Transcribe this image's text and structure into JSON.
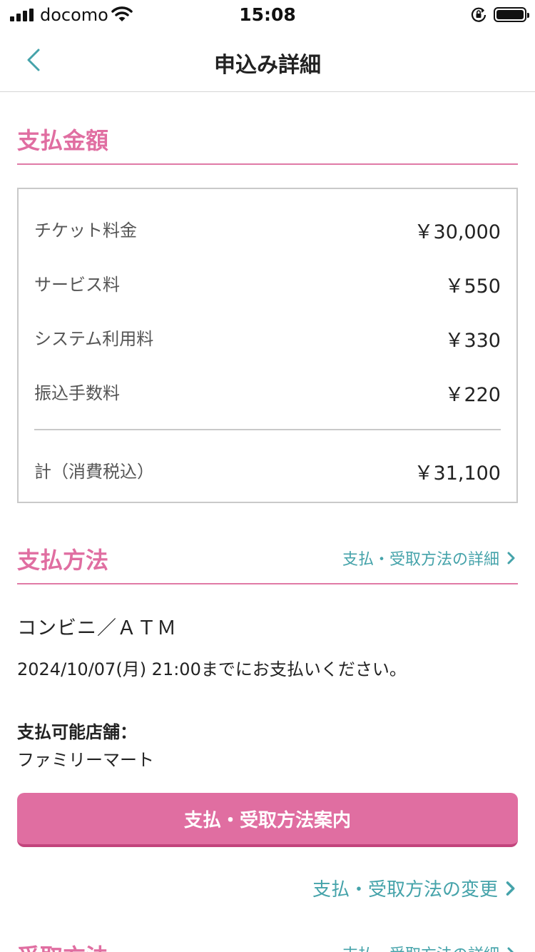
{
  "status_bar": {
    "carrier": "docomo",
    "time": "15:08",
    "signal_icon": "signal-bars-icon",
    "wifi_icon": "wifi-icon",
    "orientation_lock_icon": "orientation-lock-icon",
    "battery_icon": "battery-icon",
    "battery_level": 1.0
  },
  "nav": {
    "title": "申込み詳細",
    "back_icon": "chevron-left-icon"
  },
  "payment_amount": {
    "title": "支払金額",
    "rows": [
      {
        "label": "チケット料金",
        "value": "￥30,000"
      },
      {
        "label": "サービス料",
        "value": "￥550"
      },
      {
        "label": "システム利用料",
        "value": "￥330"
      },
      {
        "label": "振込手数料",
        "value": "￥220"
      }
    ],
    "total": {
      "label": "計（消費税込）",
      "value": "￥31,100"
    }
  },
  "payment_method": {
    "title": "支払方法",
    "detail_link": "支払・受取方法の詳細",
    "method": "コンビニ／ＡＴＭ",
    "deadline": "2024/10/07(月) 21:00までにお支払いください。",
    "store_label": "支払可能店舗：",
    "store_name": "ファミリーマート",
    "guide_button": "支払・受取方法案内",
    "change_link": "支払・受取方法の変更"
  },
  "receive_method": {
    "title": "受取方法",
    "detail_link": "支払・受取方法の詳細"
  },
  "colors": {
    "accent_pink": "#e06ea1",
    "link_teal": "#45a3aa"
  }
}
